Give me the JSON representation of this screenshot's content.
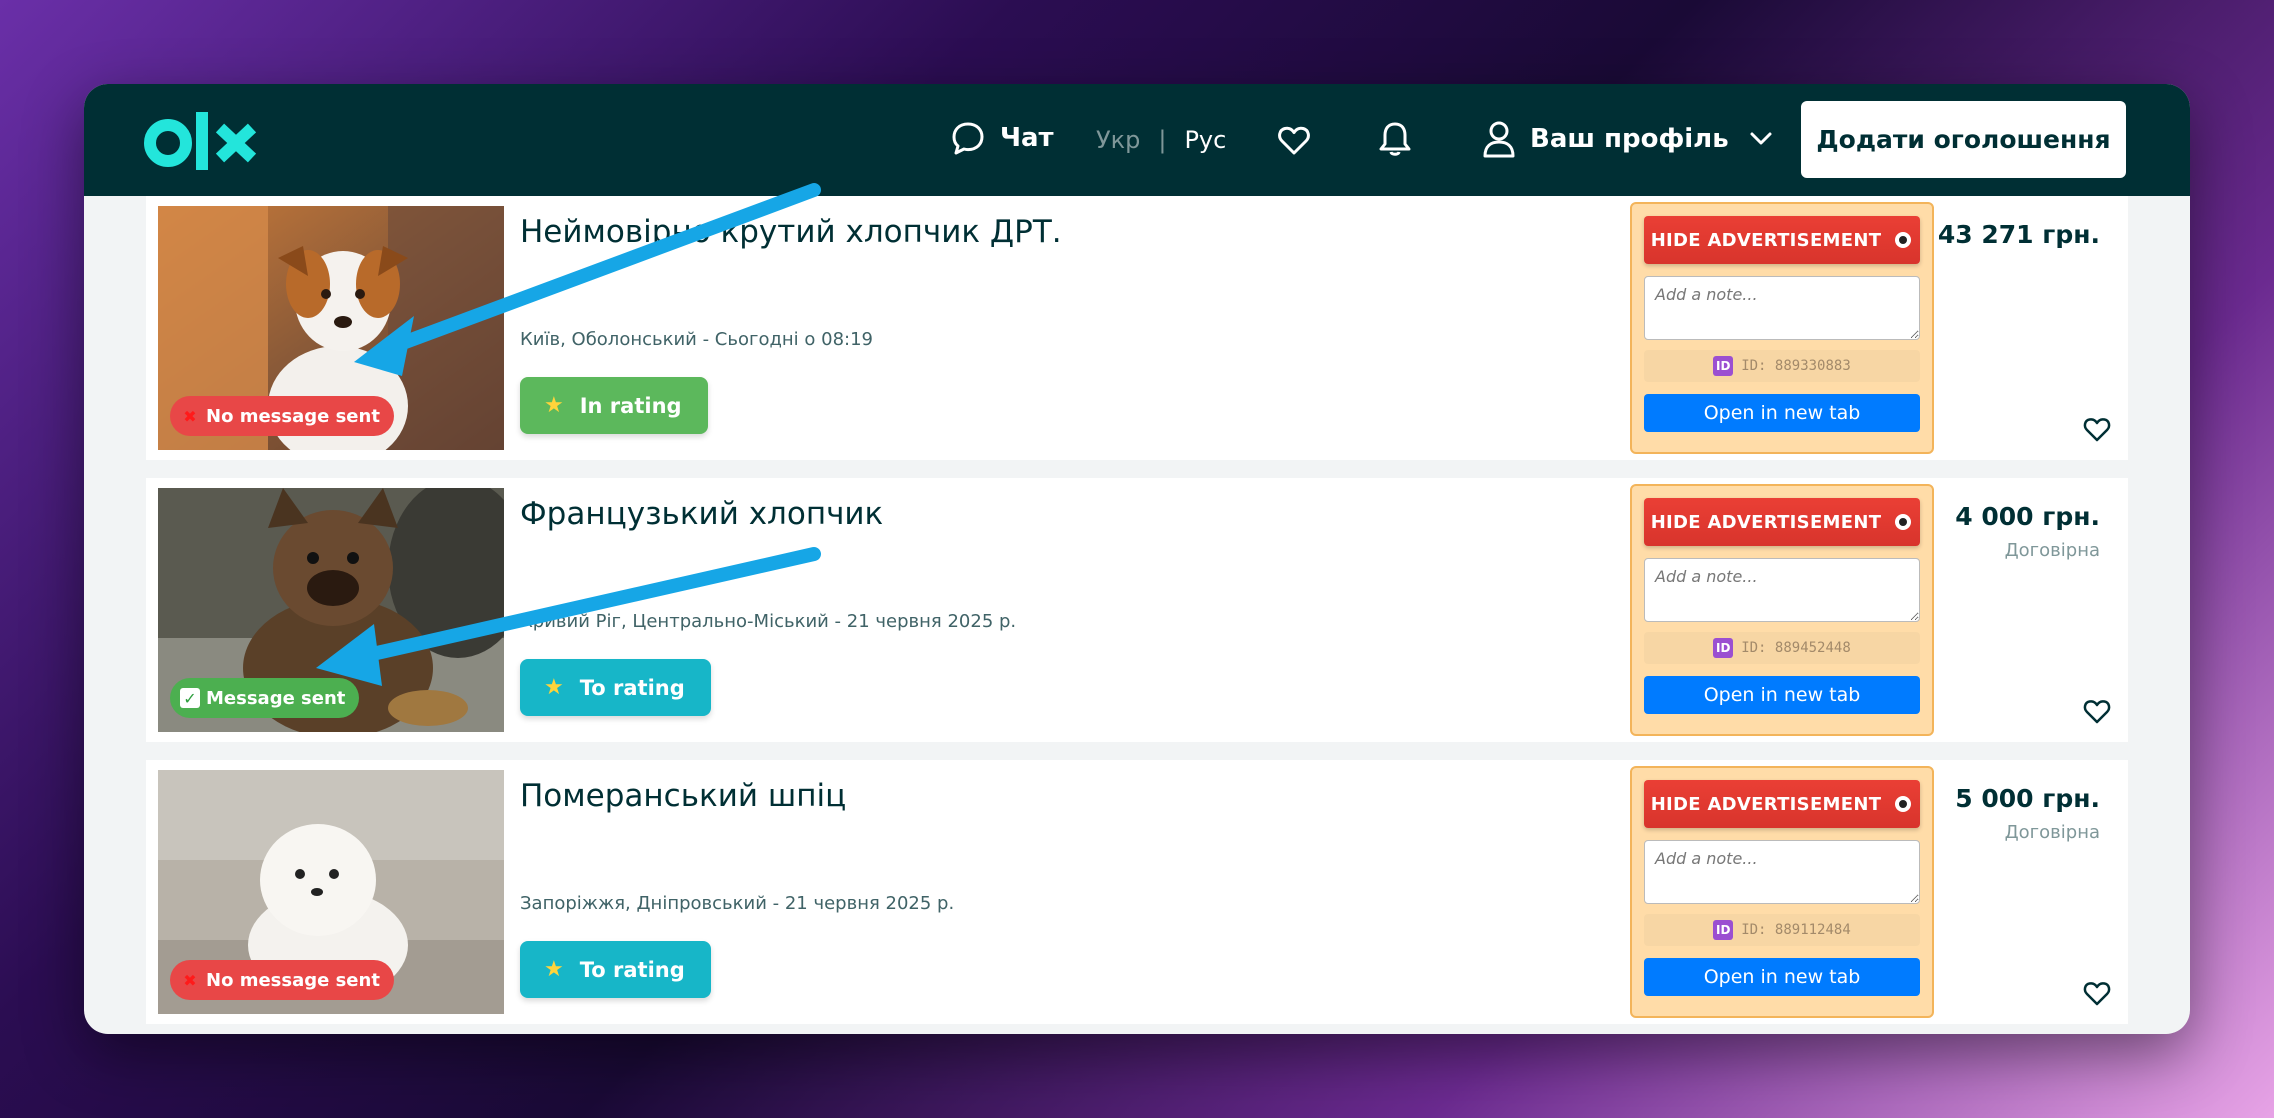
{
  "header": {
    "chat_label": "Чат",
    "lang_ukr": "Укр",
    "lang_sep": "|",
    "lang_rus": "Рус",
    "profile_label": "Ваш профіль",
    "add_button": "Додати оголошення",
    "brand_color": "#002f34",
    "logo_color": "#23e5db"
  },
  "listings": [
    {
      "title": "Неймовірно крутий хлопчик ДРТ.",
      "location": "Київ, Оболонський - Сьогодні о 08:19",
      "status": "No message sent",
      "status_type": "red",
      "rating_label": "In rating",
      "rating_type": "green",
      "price": "43 271 грн.",
      "negotiable": "",
      "hide_label": "HIDE ADVERTISEMENT",
      "note_placeholder": "Add a note...",
      "id_label": "ID: 889330883",
      "open_label": "Open in new tab"
    },
    {
      "title": "Французький хлопчик",
      "location": "Кривий Ріг, Центрально-Міський - 21 червня 2025 р.",
      "status": "Message sent",
      "status_type": "green",
      "rating_label": "To rating",
      "rating_type": "teal",
      "price": "4 000 грн.",
      "negotiable": "Договірна",
      "hide_label": "HIDE ADVERTISEMENT",
      "note_placeholder": "Add a note...",
      "id_label": "ID: 889452448",
      "open_label": "Open in new tab"
    },
    {
      "title": "Померанський шпіц",
      "location": "Запоріжжя, Дніпровський - 21 червня 2025 р.",
      "status": "No message sent",
      "status_type": "red",
      "rating_label": "To rating",
      "rating_type": "teal",
      "price": "5 000 грн.",
      "negotiable": "Договірна",
      "hide_label": "HIDE ADVERTISEMENT",
      "note_placeholder": "Add a note...",
      "id_label": "ID: 889112484",
      "open_label": "Open in new tab"
    }
  ],
  "icons": {
    "chat": "chat-bubble-icon",
    "favorite": "heart-icon",
    "notifications": "bell-icon",
    "profile": "user-icon",
    "dropdown": "chevron-down-icon",
    "hide": "eye-icon",
    "id": "id-badge-icon",
    "star": "star-icon"
  }
}
